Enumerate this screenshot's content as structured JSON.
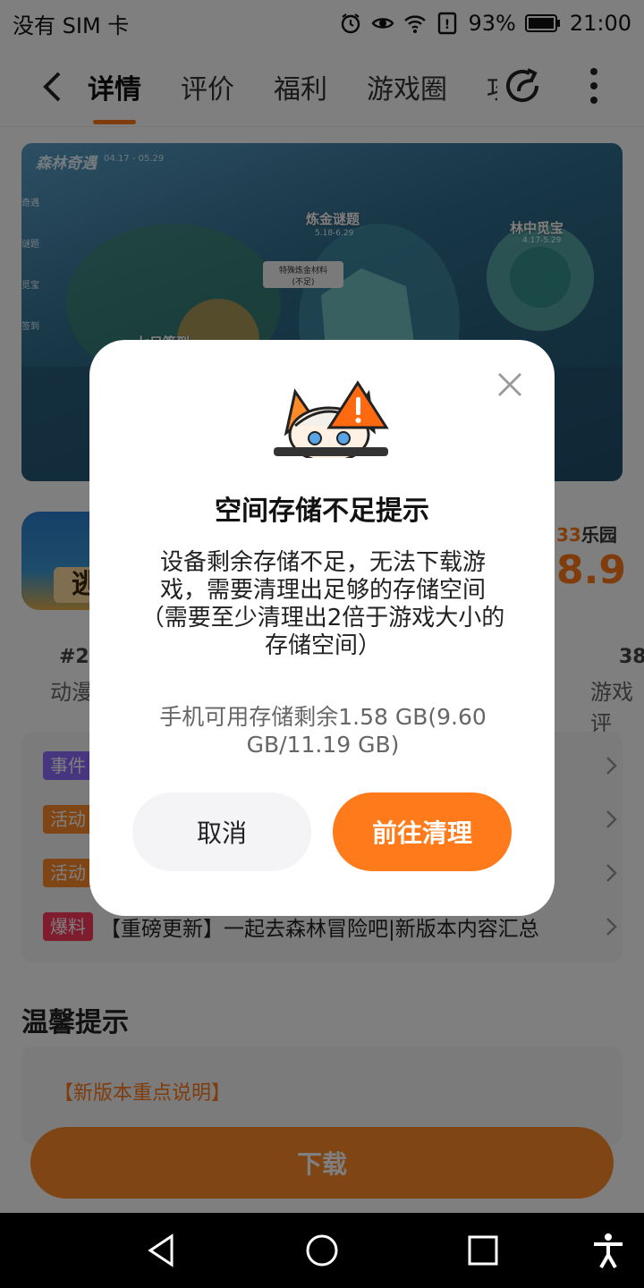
{
  "status_bar": {
    "carrier": "没有 SIM 卡",
    "battery": "93%",
    "time": "21:00"
  },
  "header": {
    "tabs": [
      {
        "label": "详情"
      },
      {
        "label": "评价"
      },
      {
        "label": "福利"
      },
      {
        "label": "游戏圈"
      },
      {
        "label": "攻"
      }
    ]
  },
  "banner": {
    "title": "森林奇遇",
    "date": "04.17 - 05.29",
    "side_items": [
      "奇遇",
      "谜题",
      "觅宝",
      "签到"
    ],
    "labels": {
      "alchemy": "炼金谜题",
      "alchemy_sub": "5.18-6.29",
      "treasure": "林中觅宝",
      "treasure_sub": "4.17-5.29",
      "tag": "特殊炼金材料",
      "tag_sub": "(不足)",
      "bottom": "七日签到"
    }
  },
  "game": {
    "icon_text": "逃",
    "brand_num": "33",
    "brand_name": "乐园",
    "score": "8.9",
    "rank": "#2",
    "rank_label": "动漫",
    "reviews": "38",
    "reviews_label": "游戏评"
  },
  "news": {
    "items": [
      {
        "badge": "事件",
        "text": ""
      },
      {
        "badge": "活动",
        "text": ""
      },
      {
        "badge": "活动",
        "text": ""
      },
      {
        "badge": "爆料",
        "text": "【重磅更新】一起去森林冒险吧|新版本内容汇总"
      }
    ]
  },
  "tips": {
    "title": "温馨提示",
    "card_title": "【新版本重点说明】"
  },
  "download": {
    "label": "下载"
  },
  "dialog": {
    "title": "空间存储不足提示",
    "body": "设备剩余存储不足，无法下载游戏，需要清理出足够的存储空间（需要至少清理出2倍于游戏大小的存储空间）",
    "storage": "手机可用存储剩余1.58 GB(9.60 GB/11.19 GB)",
    "cancel": "取消",
    "confirm": "前往清理"
  },
  "colors": {
    "accent": "#ff7a1a",
    "overlay": "rgba(0,0,0,0.5)"
  },
  "icons": [
    "alarm-icon",
    "eye-icon",
    "wifi-icon",
    "battery-icon",
    "back-icon",
    "share-icon",
    "more-icon",
    "close-icon",
    "warning-icon",
    "chevron-right-icon",
    "nav-back-icon",
    "nav-home-icon",
    "nav-recents-icon",
    "accessibility-icon"
  ]
}
